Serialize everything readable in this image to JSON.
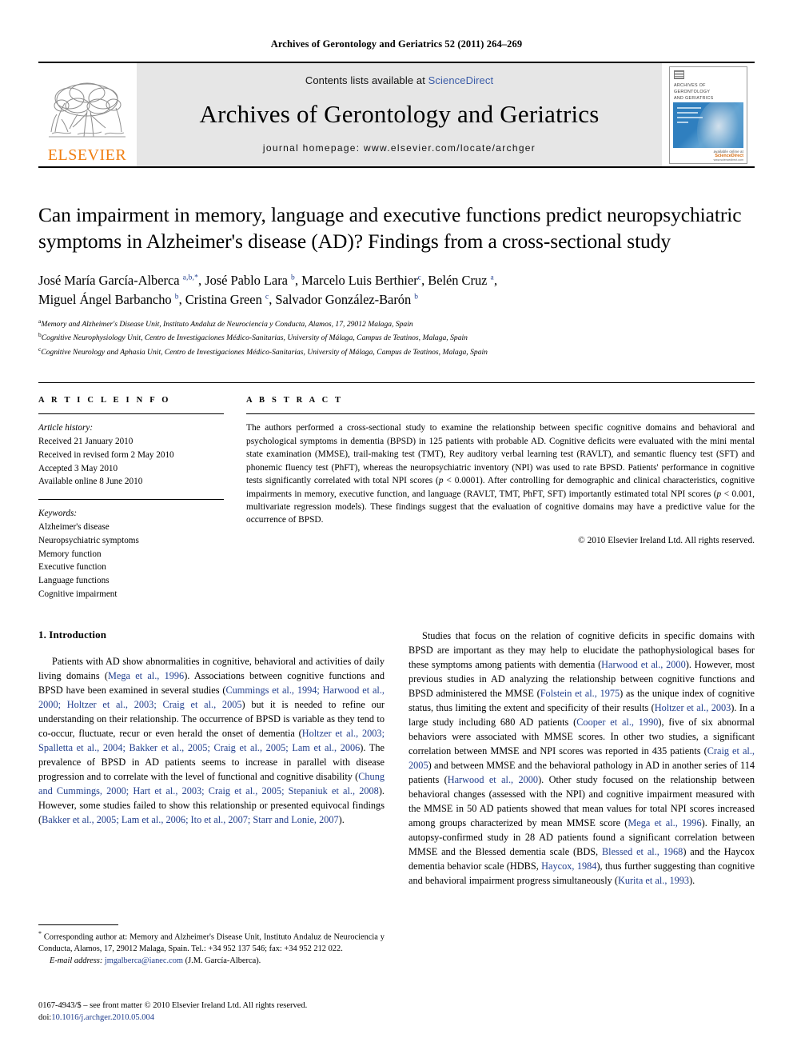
{
  "running_head": "Archives of Gerontology and Geriatrics 52 (2011) 264–269",
  "banner": {
    "publisher_name": "ELSEVIER",
    "contents_prefix": "Contents lists available at ",
    "contents_link": "ScienceDirect",
    "journal_title": "Archives of Gerontology and Geriatrics",
    "homepage": "journal homepage: www.elsevier.com/locate/archger",
    "cover": {
      "title_line1": "ARCHIVES OF GERONTOLOGY",
      "title_line2": "AND GERIATRICS",
      "sd_small": "available online at",
      "sd_main": "ScienceDirect",
      "sd_url": "www.sciencedirect.com"
    }
  },
  "article": {
    "title": "Can impairment in memory, language and executive functions predict neuropsychiatric symptoms in Alzheimer's disease (AD)? Findings from a cross-sectional study",
    "authors_line1_a": "José María García-Alberca ",
    "authors_line1_a_sup": "a,b,*",
    "authors_line1_b": ", José Pablo Lara ",
    "authors_line1_b_sup": "b",
    "authors_line1_c": ", Marcelo Luis Berthier",
    "authors_line1_c_sup": "c",
    "authors_line1_d": ", Belén Cruz ",
    "authors_line1_d_sup": "a",
    "authors_line1_end": ",",
    "authors_line2_a": "Miguel Ángel Barbancho ",
    "authors_line2_a_sup": "b",
    "authors_line2_b": ", Cristina Green ",
    "authors_line2_b_sup": "c",
    "authors_line2_c": ", Salvador González-Barón ",
    "authors_line2_c_sup": "b",
    "affiliations": [
      {
        "mark": "a",
        "text": "Memory and Alzheimer's Disease Unit, Instituto Andaluz de Neurociencia y Conducta, Alamos, 17, 29012 Malaga, Spain"
      },
      {
        "mark": "b",
        "text": "Cognitive Neurophysiology Unit, Centro de Investigaciones Médico-Sanitarias, University of Málaga, Campus de Teatinos, Malaga, Spain"
      },
      {
        "mark": "c",
        "text": "Cognitive Neurology and Aphasia Unit, Centro de Investigaciones Médico-Sanitarias, University of Málaga, Campus de Teatinos, Malaga, Spain"
      }
    ]
  },
  "article_info": {
    "heading": "A R T I C L E   I N F O",
    "history_label": "Article history:",
    "history": [
      "Received 21 January 2010",
      "Received in revised form 2 May 2010",
      "Accepted 3 May 2010",
      "Available online 8 June 2010"
    ],
    "keywords_label": "Keywords:",
    "keywords": [
      "Alzheimer's disease",
      "Neuropsychiatric symptoms",
      "Memory function",
      "Executive function",
      "Language functions",
      "Cognitive impairment"
    ]
  },
  "abstract": {
    "heading": "A B S T R A C T",
    "part1": "The authors performed a cross-sectional study to examine the relationship between specific cognitive domains and behavioral and psychological symptoms in dementia (BPSD) in 125 patients with probable AD. Cognitive deficits were evaluated with the mini mental state examination (MMSE), trail-making test (TMT), Rey auditory verbal learning test (RAVLT), and semantic fluency test (SFT) and phonemic fluency test (PhFT), whereas the neuropsychiatric inventory (NPI) was used to rate BPSD. Patients' performance in cognitive tests significantly correlated with total NPI scores (",
    "p1_italic": "p",
    "p1_value": " < 0.0001). After controlling for demographic and clinical characteristics, cognitive impairments in memory, executive function, and language (RAVLT, TMT, PhFT, SFT) importantly estimated total NPI scores (",
    "p2_italic": "p",
    "p2_value": " < 0.001, multivariate regression models). These findings suggest that the evaluation of cognitive domains may have a predictive value for the occurrence of BPSD.",
    "copyright": "© 2010 Elsevier Ireland Ltd. All rights reserved."
  },
  "introduction": {
    "heading": "1. Introduction",
    "left_p1_t1": "Patients with AD show abnormalities in cognitive, behavioral and activities of daily living domains (",
    "left_p1_c1": "Mega et al., 1996",
    "left_p1_t2": "). Associations between cognitive functions and BPSD have been examined in several studies (",
    "left_p1_c2": "Cummings et al., 1994; Harwood et al., 2000; Holtzer et al., 2003; Craig et al., 2005",
    "left_p1_t3": ") but it is needed to refine our understanding on their relationship. The occurrence of BPSD is variable as they tend to co-occur, fluctuate, recur or even herald the onset of dementia (",
    "left_p1_c3": "Holtzer et al., 2003; Spalletta et al., 2004; Bakker et al., 2005; Craig et al., 2005; Lam et al., 2006",
    "left_p1_t4": "). The prevalence of BPSD in AD patients seems to increase in parallel with disease progression and to correlate with the level of functional and cognitive disability (",
    "left_p1_c4": "Chung and Cummings, 2000; Hart et al., 2003; Craig et al., 2005; Stepaniuk et al., 2008",
    "left_p1_t5": "). However, some studies failed to show this relationship or presented equivocal findings (",
    "left_p1_c5": "Bakker et al., 2005; Lam et al., 2006; Ito et al., 2007; Starr and Lonie, 2007",
    "left_p1_t6": ").",
    "right_p1_t1": "Studies that focus on the relation of cognitive deficits in specific domains with BPSD are important as they may help to elucidate the pathophysiological bases for these symptoms among patients with dementia (",
    "right_p1_c1": "Harwood et al., 2000",
    "right_p1_t2": "). However, most previous studies in AD analyzing the relationship between cognitive functions and BPSD administered the MMSE (",
    "right_p1_c2": "Folstein et al., 1975",
    "right_p1_t3": ") as the unique index of cognitive status, thus limiting the extent and specificity of their results (",
    "right_p1_c3": "Holtzer et al., 2003",
    "right_p1_t4": "). In a large study including 680 AD patients (",
    "right_p1_c4": "Cooper et al., 1990",
    "right_p1_t5": "), five of six abnormal behaviors were associated with MMSE scores. In other two studies, a significant correlation between MMSE and NPI scores was reported in 435 patients (",
    "right_p1_c5": "Craig et al., 2005",
    "right_p1_t6": ") and between MMSE and the behavioral pathology in AD in another series of 114 patients (",
    "right_p1_c6": "Harwood et al., 2000",
    "right_p1_t7": "). Other study focused on the relationship between behavioral changes (assessed with the NPI) and cognitive impairment measured with the MMSE in 50 AD patients showed that mean values for total NPI scores increased among groups characterized by mean MMSE score (",
    "right_p1_c7": "Mega et al., 1996",
    "right_p1_t8": "). Finally, an autopsy-confirmed study in 28 AD patients found a significant correlation between MMSE and the Blessed dementia scale (BDS, ",
    "right_p1_c8": "Blessed et al., 1968",
    "right_p1_t9": ") and the Haycox dementia behavior scale (HDBS, ",
    "right_p1_c9": "Haycox, 1984",
    "right_p1_t10": "), thus further suggesting than cognitive and behavioral impairment progress simultaneously (",
    "right_p1_c10": "Kurita et al., 1993",
    "right_p1_t11": ")."
  },
  "footnote": {
    "star": "*",
    "text": " Corresponding author at: Memory and Alzheimer's Disease Unit, Instituto Andaluz de Neurociencia y Conducta, Alamos, 17, 29012 Malaga, Spain. Tel.: +34 952 137 546; fax: +34 952 212 022.",
    "email_label": "E-mail address:",
    "email": "jmgalberca@ianec.com",
    "email_owner": "(J.M. García-Alberca)."
  },
  "colophon": {
    "line1": "0167-4943/$ – see front matter © 2010 Elsevier Ireland Ltd. All rights reserved.",
    "doi_label": "doi:",
    "doi": "10.1016/j.archger.2010.05.004"
  }
}
